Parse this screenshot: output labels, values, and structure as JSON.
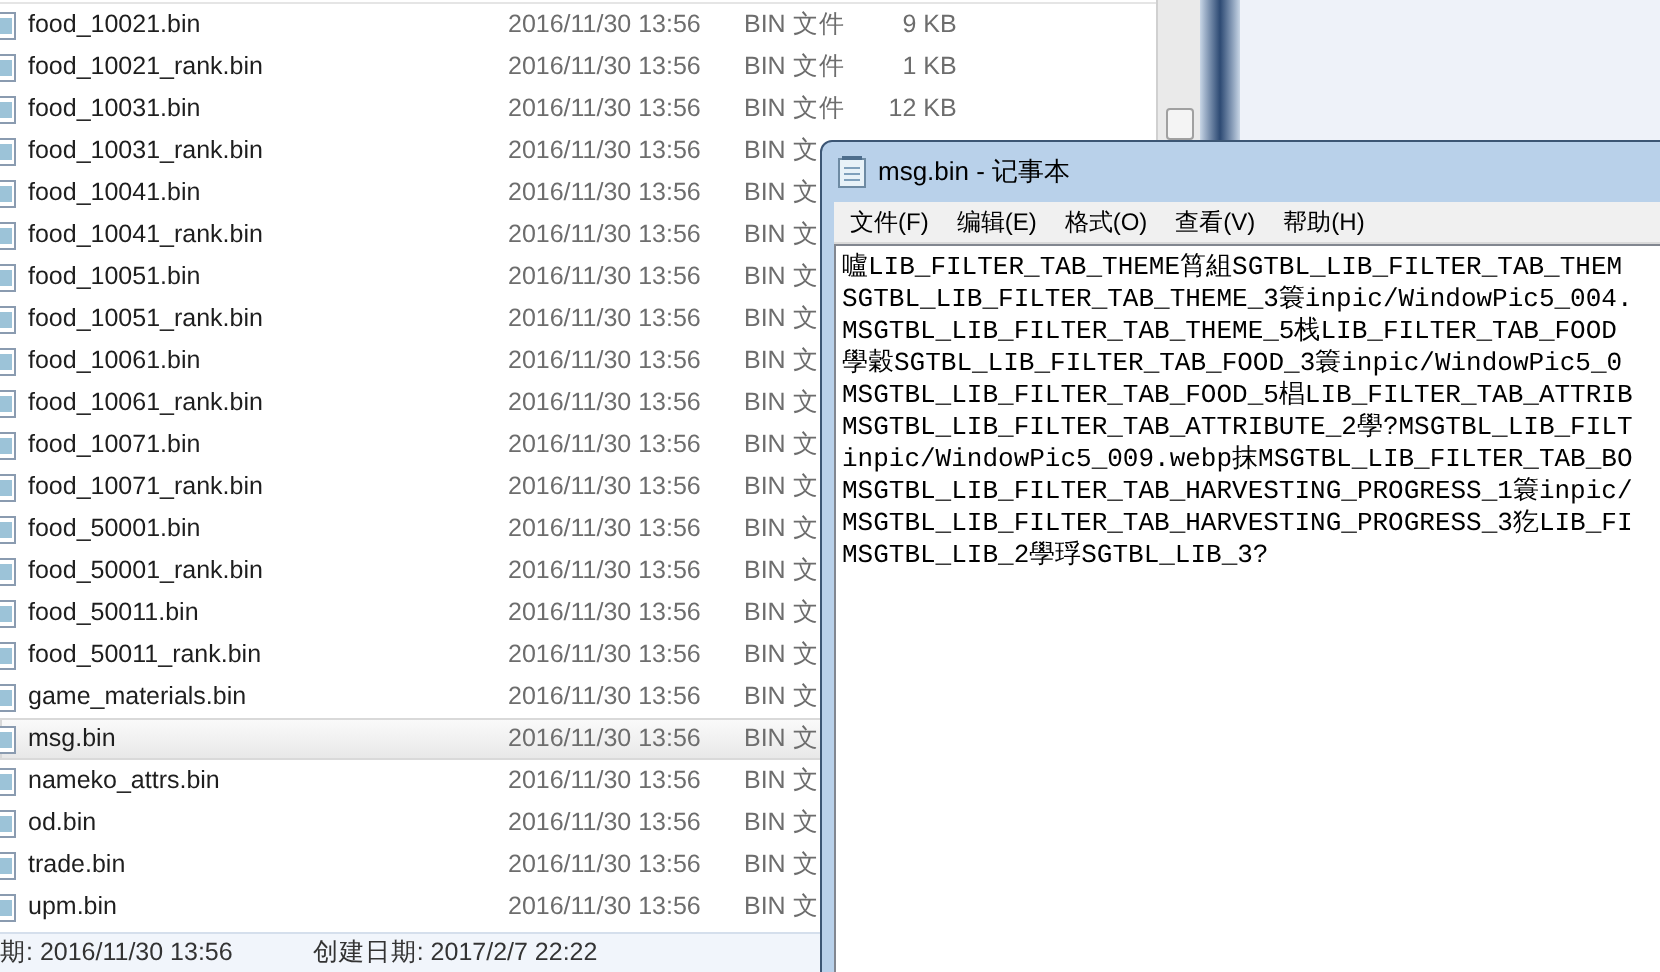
{
  "explorer": {
    "files": [
      {
        "name": "food_10021.bin",
        "modified": "2016/11/30 13:56",
        "type": "BIN 文件",
        "size": "9 KB",
        "selected": false
      },
      {
        "name": "food_10021_rank.bin",
        "modified": "2016/11/30 13:56",
        "type": "BIN 文件",
        "size": "1 KB",
        "selected": false
      },
      {
        "name": "food_10031.bin",
        "modified": "2016/11/30 13:56",
        "type": "BIN 文件",
        "size": "12 KB",
        "selected": false
      },
      {
        "name": "food_10031_rank.bin",
        "modified": "2016/11/30 13:56",
        "type": "BIN 文",
        "selected": false
      },
      {
        "name": "food_10041.bin",
        "modified": "2016/11/30 13:56",
        "type": "BIN 文",
        "selected": false
      },
      {
        "name": "food_10041_rank.bin",
        "modified": "2016/11/30 13:56",
        "type": "BIN 文",
        "selected": false
      },
      {
        "name": "food_10051.bin",
        "modified": "2016/11/30 13:56",
        "type": "BIN 文",
        "selected": false
      },
      {
        "name": "food_10051_rank.bin",
        "modified": "2016/11/30 13:56",
        "type": "BIN 文",
        "selected": false
      },
      {
        "name": "food_10061.bin",
        "modified": "2016/11/30 13:56",
        "type": "BIN 文",
        "selected": false
      },
      {
        "name": "food_10061_rank.bin",
        "modified": "2016/11/30 13:56",
        "type": "BIN 文",
        "selected": false
      },
      {
        "name": "food_10071.bin",
        "modified": "2016/11/30 13:56",
        "type": "BIN 文",
        "selected": false
      },
      {
        "name": "food_10071_rank.bin",
        "modified": "2016/11/30 13:56",
        "type": "BIN 文",
        "selected": false
      },
      {
        "name": "food_50001.bin",
        "modified": "2016/11/30 13:56",
        "type": "BIN 文",
        "selected": false
      },
      {
        "name": "food_50001_rank.bin",
        "modified": "2016/11/30 13:56",
        "type": "BIN 文",
        "selected": false
      },
      {
        "name": "food_50011.bin",
        "modified": "2016/11/30 13:56",
        "type": "BIN 文",
        "selected": false
      },
      {
        "name": "food_50011_rank.bin",
        "modified": "2016/11/30 13:56",
        "type": "BIN 文",
        "selected": false
      },
      {
        "name": "game_materials.bin",
        "modified": "2016/11/30 13:56",
        "type": "BIN 文",
        "selected": false
      },
      {
        "name": "msg.bin",
        "modified": "2016/11/30 13:56",
        "type": "BIN 文",
        "selected": true
      },
      {
        "name": "nameko_attrs.bin",
        "modified": "2016/11/30 13:56",
        "type": "BIN 文",
        "selected": false
      },
      {
        "name": "od.bin",
        "modified": "2016/11/30 13:56",
        "type": "BIN 文",
        "selected": false
      },
      {
        "name": "trade.bin",
        "modified": "2016/11/30 13:56",
        "type": "BIN 文",
        "selected": false
      },
      {
        "name": "upm.bin",
        "modified": "2016/11/30 13:56",
        "type": "BIN 文",
        "selected": false
      }
    ],
    "status_bar": {
      "modified": "期: 2016/11/30 13:56",
      "created": "创建日期: 2017/2/7 22:22"
    }
  },
  "notepad": {
    "title": "msg.bin - 记事本",
    "menu": [
      "文件(F)",
      "编辑(E)",
      "格式(O)",
      "查看(V)",
      "帮助(H)"
    ],
    "lines": [
      "嚧LIB_FILTER_TAB_THEME筲組SGTBL_LIB_FILTER_TAB_THEM",
      "SGTBL_LIB_FILTER_TAB_THEME_3簑inpic/WindowPic5_004.",
      "MSGTBL_LIB_FILTER_TAB_THEME_5栈LIB_FILTER_TAB_FOOD",
      "學穀SGTBL_LIB_FILTER_TAB_FOOD_3簑inpic/WindowPic5_0",
      "MSGTBL_LIB_FILTER_TAB_FOOD_5椙LIB_FILTER_TAB_ATTRIB",
      "MSGTBL_LIB_FILTER_TAB_ATTRIBUTE_2學?MSGTBL_LIB_FILT",
      "inpic/WindowPic5_009.webp抹MSGTBL_LIB_FILTER_TAB_BO",
      "MSGTBL_LIB_FILTER_TAB_HARVESTING_PROGRESS_1簑inpic/",
      "MSGTBL_LIB_FILTER_TAB_HARVESTING_PROGRESS_3犵LIB_FI",
      "MSGTBL_LIB_2學琈SGTBL_LIB_3?"
    ]
  }
}
